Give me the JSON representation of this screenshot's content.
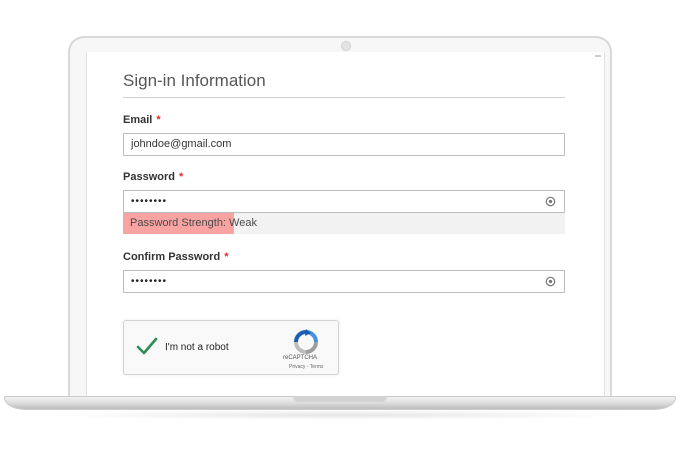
{
  "form": {
    "heading": "Sign-in Information",
    "required_marker": "*",
    "email": {
      "label": "Email",
      "value": "johndoe@gmail.com"
    },
    "password": {
      "label": "Password",
      "value": "••••••••",
      "icon": "eye-icon"
    },
    "password_strength": {
      "text": "Password Strength: Weak",
      "level": 0.25,
      "color": "#f9a3a3"
    },
    "confirm_password": {
      "label": "Confirm Password",
      "value": "••••••••",
      "icon": "eye-icon"
    },
    "recaptcha": {
      "label": "I'm not a robot",
      "brand": "reCAPTCHA",
      "links": "Privacy - Terms",
      "checked": true,
      "check_color": "#2e8b57"
    }
  },
  "colors": {
    "required": "#e02b27",
    "heading": "#575757"
  }
}
